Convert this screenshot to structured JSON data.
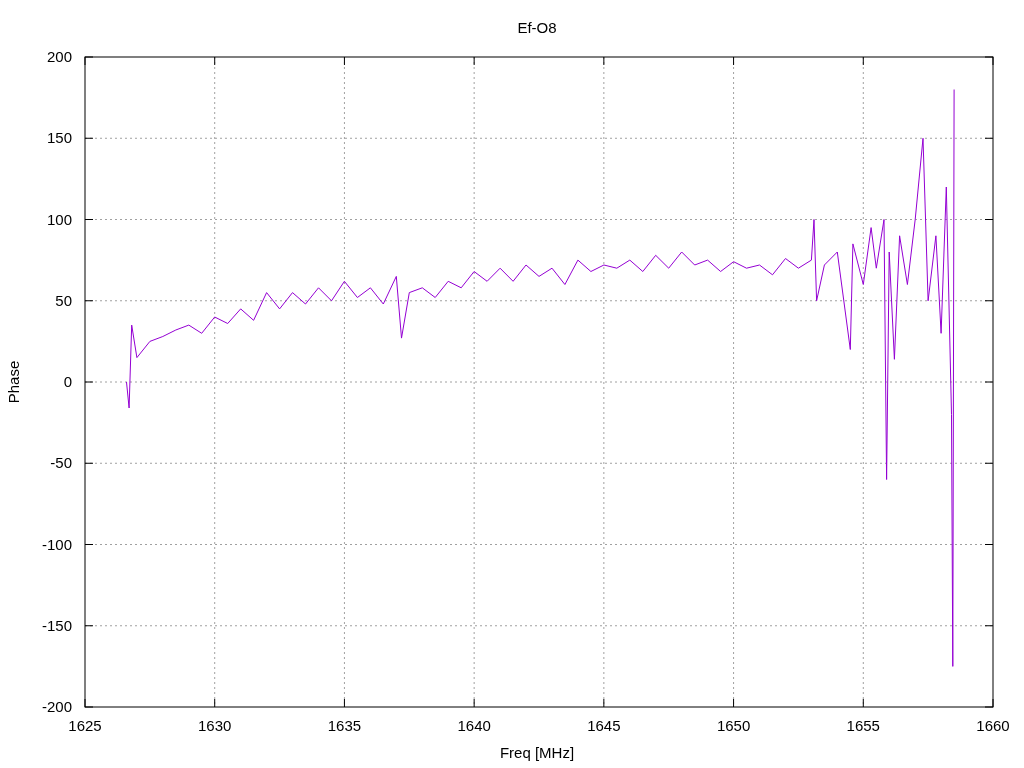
{
  "chart_data": {
    "type": "line",
    "title": "Ef-O8",
    "xlabel": "Freq [MHz]",
    "ylabel": "Phase",
    "xlim": [
      1625,
      1660
    ],
    "ylim": [
      -200,
      200
    ],
    "xticks": [
      1625,
      1630,
      1635,
      1640,
      1645,
      1650,
      1655,
      1660
    ],
    "yticks": [
      -200,
      -150,
      -100,
      -50,
      0,
      50,
      100,
      150,
      200
    ],
    "grid": true,
    "series": [
      {
        "color": "#9400d3",
        "x": [
          1626.6,
          1626.7,
          1626.8,
          1627,
          1627.5,
          1628,
          1628.5,
          1629,
          1629.5,
          1630,
          1630.5,
          1631,
          1631.5,
          1632,
          1632.5,
          1633,
          1633.5,
          1634,
          1634.5,
          1635,
          1635.5,
          1636,
          1636.5,
          1637,
          1637.2,
          1637.5,
          1638,
          1638.5,
          1639,
          1639.5,
          1640,
          1640.5,
          1641,
          1641.5,
          1642,
          1642.5,
          1643,
          1643.5,
          1644,
          1644.5,
          1645,
          1645.5,
          1646,
          1646.5,
          1647,
          1647.5,
          1648,
          1648.5,
          1649,
          1649.5,
          1650,
          1650.5,
          1651,
          1651.5,
          1652,
          1652.5,
          1653,
          1653.1,
          1653.2,
          1653.5,
          1654,
          1654.5,
          1654.6,
          1655,
          1655.3,
          1655.5,
          1655.8,
          1655.9,
          1656,
          1656.2,
          1656.4,
          1656.7,
          1657,
          1657.3,
          1657.5,
          1657.8,
          1658,
          1658.2,
          1658.4,
          1658.45,
          1658.5
        ],
        "values": [
          0,
          -16,
          35,
          15,
          25,
          28,
          32,
          35,
          30,
          40,
          36,
          45,
          38,
          55,
          45,
          55,
          48,
          58,
          50,
          62,
          52,
          58,
          48,
          65,
          27,
          55,
          58,
          52,
          62,
          58,
          68,
          62,
          70,
          62,
          72,
          65,
          70,
          60,
          75,
          68,
          72,
          70,
          75,
          68,
          78,
          70,
          80,
          72,
          75,
          68,
          74,
          70,
          72,
          66,
          76,
          70,
          75,
          100,
          50,
          72,
          80,
          20,
          85,
          60,
          95,
          70,
          100,
          -60,
          80,
          14,
          90,
          60,
          100,
          150,
          50,
          90,
          30,
          120,
          -20,
          -175,
          180
        ]
      }
    ]
  }
}
